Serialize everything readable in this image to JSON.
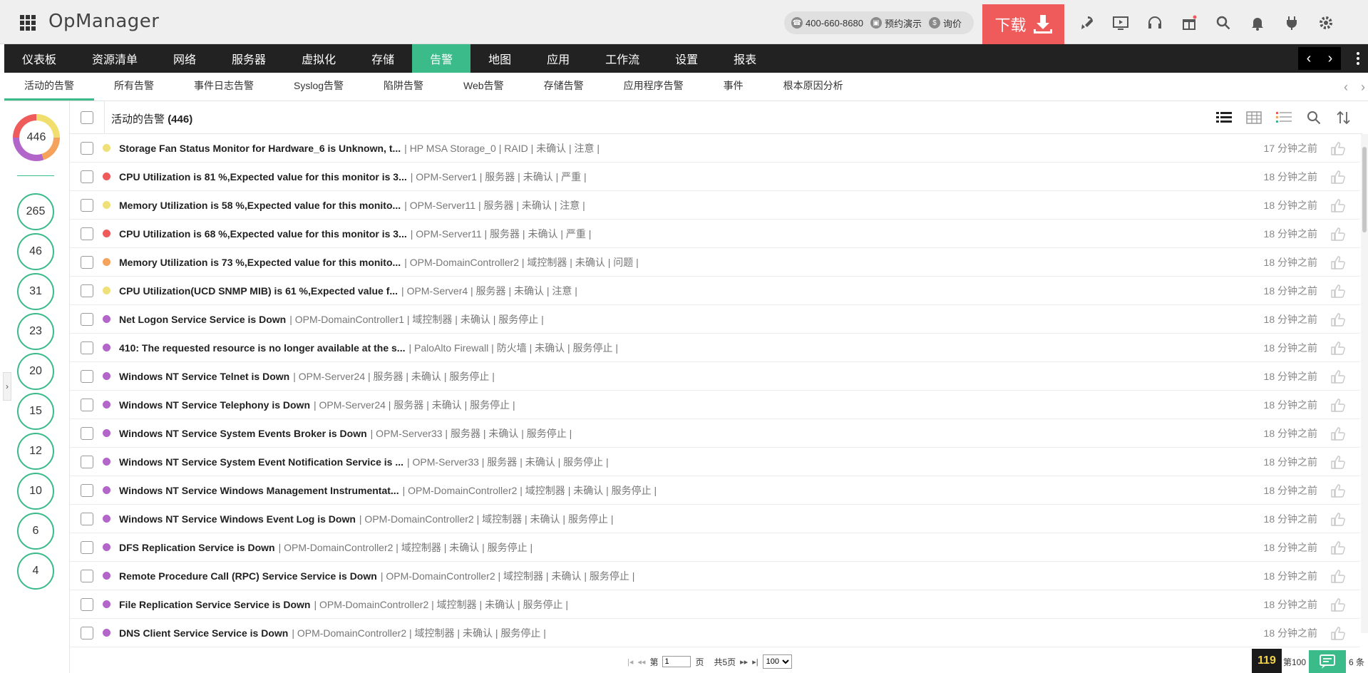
{
  "app": {
    "title": "OpManager"
  },
  "header": {
    "phone": "400-660-8680",
    "demo": "预约演示",
    "inquiry": "询价",
    "download_label": "下载",
    "icons": [
      "rocket-icon",
      "screen-icon",
      "headset-icon",
      "gift-icon",
      "search-icon",
      "bell-icon",
      "plug-icon",
      "gear-icon"
    ]
  },
  "main_nav": [
    {
      "label": "仪表板",
      "active": false
    },
    {
      "label": "资源清单",
      "active": false
    },
    {
      "label": "网络",
      "active": false
    },
    {
      "label": "服务器",
      "active": false
    },
    {
      "label": "虚拟化",
      "active": false
    },
    {
      "label": "存储",
      "active": false
    },
    {
      "label": "告警",
      "active": true
    },
    {
      "label": "地图",
      "active": false
    },
    {
      "label": "应用",
      "active": false
    },
    {
      "label": "工作流",
      "active": false
    },
    {
      "label": "设置",
      "active": false
    },
    {
      "label": "报表",
      "active": false
    }
  ],
  "sub_nav": [
    {
      "label": "活动的告警",
      "active": true
    },
    {
      "label": "所有告警",
      "active": false
    },
    {
      "label": "事件日志告警",
      "active": false
    },
    {
      "label": "Syslog告警",
      "active": false
    },
    {
      "label": "陷阱告警",
      "active": false
    },
    {
      "label": "Web告警",
      "active": false
    },
    {
      "label": "存储告警",
      "active": false
    },
    {
      "label": "应用程序告警",
      "active": false
    },
    {
      "label": "事件",
      "active": false
    },
    {
      "label": "根本原因分析",
      "active": false
    }
  ],
  "left": {
    "total": "446",
    "counts": [
      "265",
      "46",
      "31",
      "23",
      "20",
      "15",
      "12",
      "10",
      "6",
      "4"
    ]
  },
  "panel": {
    "title": "活动的告警",
    "count": "(446)"
  },
  "severity_colors": {
    "attention": "#efe07a",
    "critical": "#ef5a5a",
    "trouble": "#f5a35c",
    "service_down": "#b366c9"
  },
  "alarms": [
    {
      "msg": "Storage Fan Status Monitor for Hardware_6 is Unknown, t...",
      "meta": "| HP MSA Storage_0 | RAID | 未确认 | 注意 |",
      "time": "17 分钟之前",
      "severity": "attention"
    },
    {
      "msg": "CPU Utilization is 81 %,Expected value for this monitor is 3...",
      "meta": "| OPM-Server1 | 服务器 | 未确认 | 严重 |",
      "time": "18 分钟之前",
      "severity": "critical"
    },
    {
      "msg": "Memory Utilization is 58 %,Expected value for this monito...",
      "meta": "| OPM-Server11 | 服务器 | 未确认 | 注意 |",
      "time": "18 分钟之前",
      "severity": "attention"
    },
    {
      "msg": "CPU Utilization is 68 %,Expected value for this monitor is 3...",
      "meta": "| OPM-Server11 | 服务器 | 未确认 | 严重 |",
      "time": "18 分钟之前",
      "severity": "critical"
    },
    {
      "msg": "Memory Utilization is 73 %,Expected value for this monito...",
      "meta": "| OPM-DomainController2 | 域控制器 | 未确认 | 问题 |",
      "time": "18 分钟之前",
      "severity": "trouble"
    },
    {
      "msg": "CPU Utilization(UCD SNMP MIB) is 61 %,Expected value f...",
      "meta": "| OPM-Server4 | 服务器 | 未确认 | 注意 |",
      "time": "18 分钟之前",
      "severity": "attention"
    },
    {
      "msg": "Net Logon Service Service is Down",
      "meta": "| OPM-DomainController1 | 域控制器 | 未确认 | 服务停止 |",
      "time": "18 分钟之前",
      "severity": "service_down"
    },
    {
      "msg": "410: The requested resource is no longer available at the s...",
      "meta": "| PaloAlto Firewall | 防火墙 | 未确认 | 服务停止 |",
      "time": "18 分钟之前",
      "severity": "service_down"
    },
    {
      "msg": "Windows NT Service Telnet is Down",
      "meta": "| OPM-Server24 | 服务器 | 未确认 | 服务停止 |",
      "time": "18 分钟之前",
      "severity": "service_down"
    },
    {
      "msg": "Windows NT Service Telephony is Down",
      "meta": "| OPM-Server24 | 服务器 | 未确认 | 服务停止 |",
      "time": "18 分钟之前",
      "severity": "service_down"
    },
    {
      "msg": "Windows NT Service System Events Broker is Down",
      "meta": "| OPM-Server33 | 服务器 | 未确认 | 服务停止 |",
      "time": "18 分钟之前",
      "severity": "service_down"
    },
    {
      "msg": "Windows NT Service System Event Notification Service is ...",
      "meta": "| OPM-Server33 | 服务器 | 未确认 | 服务停止 |",
      "time": "18 分钟之前",
      "severity": "service_down"
    },
    {
      "msg": "Windows NT Service Windows Management Instrumentat...",
      "meta": "| OPM-DomainController2 | 域控制器 | 未确认 | 服务停止 |",
      "time": "18 分钟之前",
      "severity": "service_down"
    },
    {
      "msg": "Windows NT Service Windows Event Log is Down",
      "meta": "| OPM-DomainController2 | 域控制器 | 未确认 | 服务停止 |",
      "time": "18 分钟之前",
      "severity": "service_down"
    },
    {
      "msg": "DFS Replication Service is Down",
      "meta": "| OPM-DomainController2 | 域控制器 | 未确认 | 服务停止 |",
      "time": "18 分钟之前",
      "severity": "service_down"
    },
    {
      "msg": "Remote Procedure Call (RPC) Service Service is Down",
      "meta": "| OPM-DomainController2 | 域控制器 | 未确认 | 服务停止 |",
      "time": "18 分钟之前",
      "severity": "service_down"
    },
    {
      "msg": "File Replication Service Service is Down",
      "meta": "| OPM-DomainController2 | 域控制器 | 未确认 | 服务停止 |",
      "time": "18 分钟之前",
      "severity": "service_down"
    },
    {
      "msg": "DNS Client Service Service is Down",
      "meta": "| OPM-DomainController2 | 域控制器 | 未确认 | 服务停止 |",
      "time": "18 分钟之前",
      "severity": "service_down"
    }
  ],
  "pager": {
    "page_prefix": "第",
    "page_value": "1",
    "page_suffix": "页",
    "total_pages": "共5页",
    "page_size": "100",
    "badge": "119",
    "range_text": "第100",
    "end_text": "6 条"
  }
}
